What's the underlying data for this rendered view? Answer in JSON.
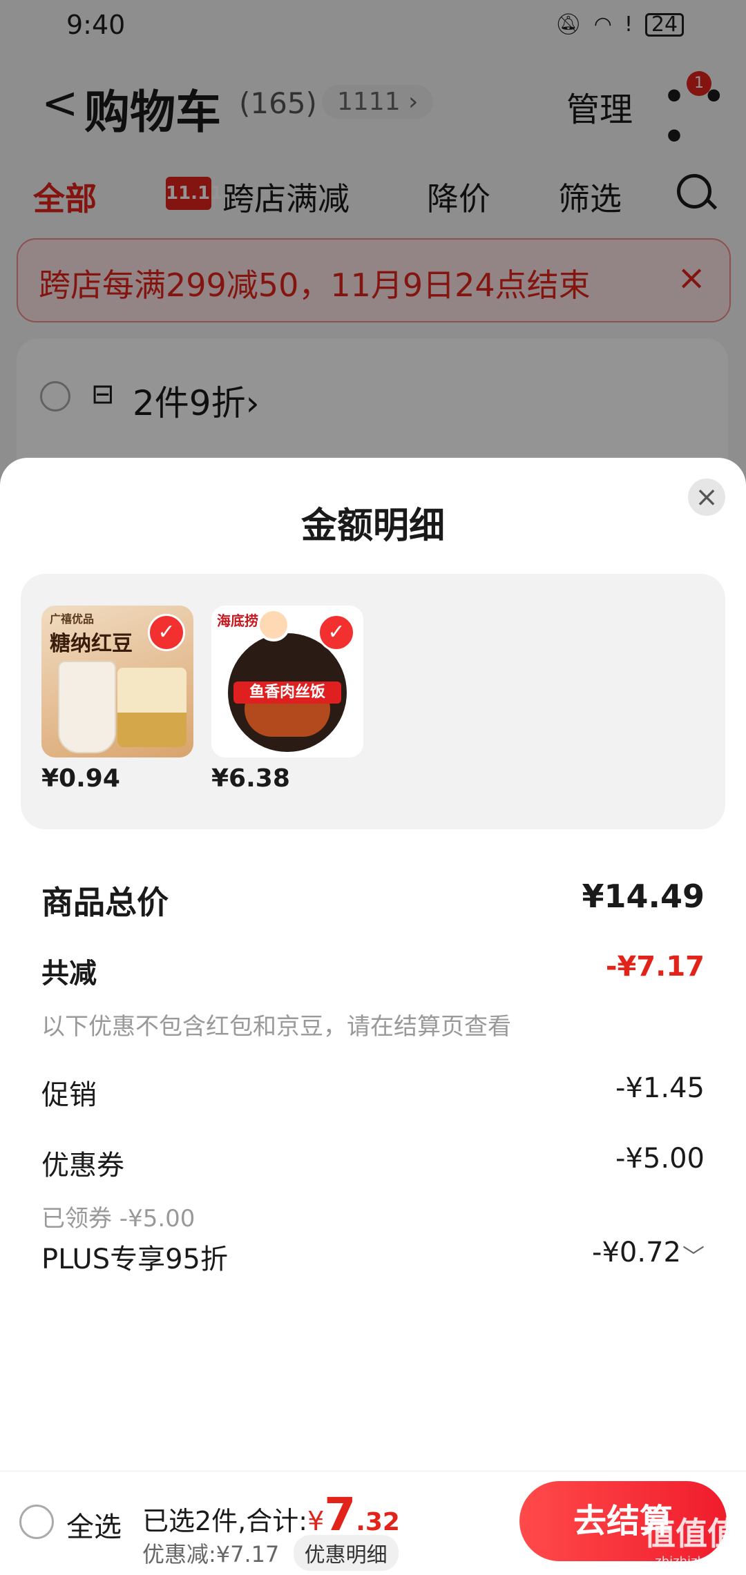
{
  "status_bar": {
    "time": "9:40",
    "battery": "24"
  },
  "header": {
    "back": "<",
    "title": "购物车",
    "count": "(165)",
    "promo_pill": "1111 ›",
    "manage": "管理",
    "more": "• • •",
    "badge": "1"
  },
  "tabs": [
    {
      "label": "全部",
      "active": true
    },
    {
      "label": "跨店满减",
      "logo": "11.11"
    },
    {
      "label": "降价"
    },
    {
      "label": "筛选"
    }
  ],
  "banner": {
    "text": "跨店每满299减50，11月9日24点结束",
    "close": "×"
  },
  "store_card": {
    "rule": "2件9折›"
  },
  "sheet": {
    "title": "金额明细",
    "close": "×",
    "products": [
      {
        "brand": "广禧优品",
        "name": "糖纳红豆",
        "price": "¥0.94",
        "check": "✓"
      },
      {
        "brand": "海底捞",
        "name": "鱼香肉丝饭",
        "price": "¥6.38",
        "check": "✓"
      }
    ],
    "total_label": "商品总价",
    "total_value": "¥14.49",
    "reduce_label": "共减",
    "reduce_value": "-¥7.17",
    "reduce_note": "以下优惠不包含红包和京豆，请在结算页查看",
    "promo_label": "促销",
    "promo_value": "-¥1.45",
    "coupon_label": "优惠券",
    "coupon_value": "-¥5.00",
    "coupon_note": "已领券 -¥5.00",
    "plus_label": "PLUS专享95折",
    "plus_value": "-¥0.72"
  },
  "bottom": {
    "select_all": "全选",
    "selected_prefix": "已选2件,合计:",
    "currency": "¥",
    "total_int": "7",
    "total_dec": ".32",
    "discount_text": "优惠减:¥7.17",
    "detail_button": "优惠明细",
    "checkout": "去结算"
  },
  "watermark": {
    "main": "值值值",
    "sub": "zhizhizhi.com"
  },
  "colors": {
    "accent": "#e2231a",
    "checkout": "#f01c2c"
  }
}
